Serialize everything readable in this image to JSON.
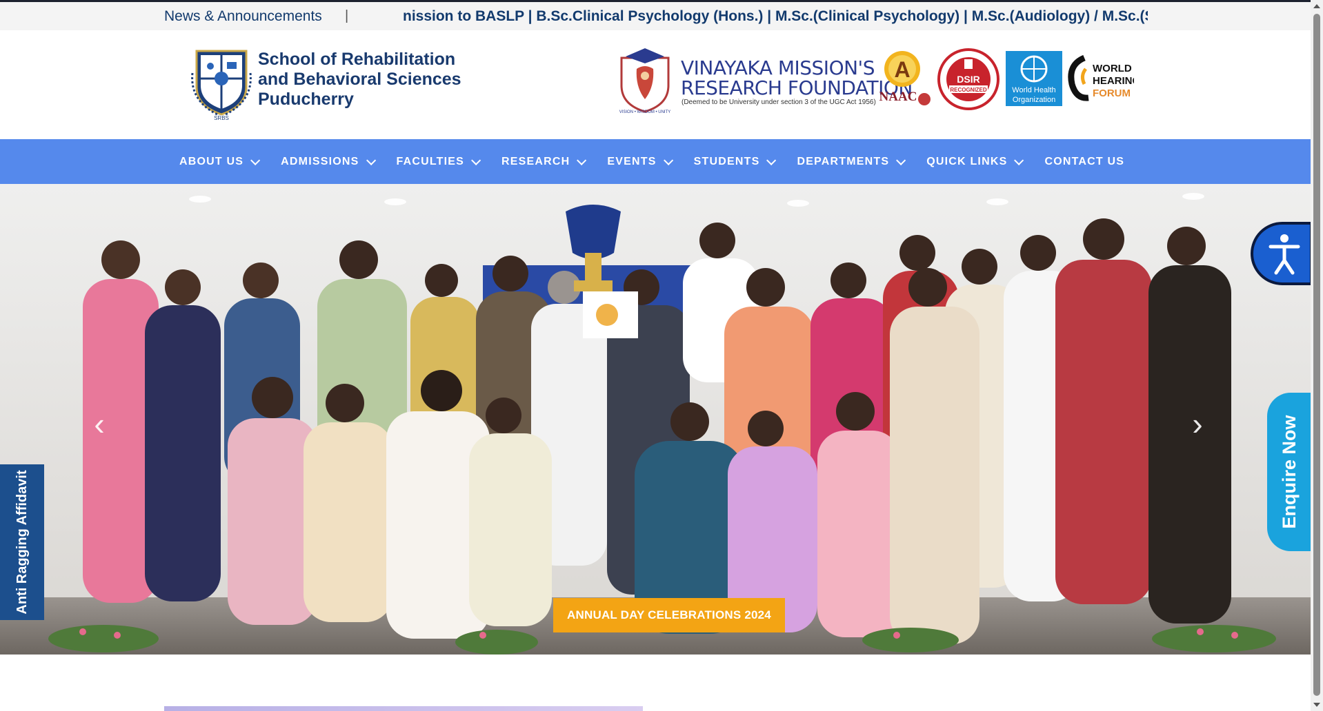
{
  "ticker": {
    "title": "News & Announcements",
    "separator": "|",
    "text": "nission to BASLP | B.Sc.Clinical Psychology (Hons.) | M.Sc.(Clinical Psychology) | M.Sc.(Audiology) / M.Sc.(Speecl"
  },
  "header": {
    "school_name": [
      "School of Rehabilitation",
      "and Behavioral Sciences",
      "Puducherry"
    ],
    "school_logo_text": "SRBS",
    "partner_name": [
      "VINAYAKA MISSION'S",
      "RESEARCH FOUNDATION"
    ],
    "partner_subtitle": "(Deemed to be University under section 3 of the UGC Act 1956)",
    "partner_logo_motto": "VISION • WISDOM • UNITY",
    "badges": {
      "naac_grade": "A",
      "naac_label": "NAAC",
      "dsir": "DSIR",
      "dsir_label": "RECOGNIZED",
      "who": "World Health Organization",
      "whf": [
        "WORLD",
        "HEARING",
        "FORUM"
      ]
    }
  },
  "nav": {
    "items": [
      {
        "label": "ABOUT US",
        "dropdown": true
      },
      {
        "label": "ADMISSIONS",
        "dropdown": true
      },
      {
        "label": "FACULTIES",
        "dropdown": true
      },
      {
        "label": "RESEARCH",
        "dropdown": true
      },
      {
        "label": "EVENTS",
        "dropdown": true
      },
      {
        "label": "STUDENTS",
        "dropdown": true
      },
      {
        "label": "DEPARTMENTS",
        "dropdown": true
      },
      {
        "label": "QUICK LINKS",
        "dropdown": true
      },
      {
        "label": "CONTACT US",
        "dropdown": false
      }
    ]
  },
  "hero": {
    "caption": "ANNUAL DAY CELEBRATIONS 2024",
    "prev_icon": "chevron-left-icon",
    "next_icon": "chevron-right-icon"
  },
  "side_tabs": {
    "anti_ragging": "Anti Ragging Affidavit",
    "enquire": "Enquire Now",
    "accessibility_icon": "accessibility-icon"
  },
  "colors": {
    "nav_bg": "#5589ec",
    "caption_bg": "#f3a414",
    "enquire_bg": "#1aa3dd",
    "anti_ragging_bg": "#1c4f8d",
    "brand_text": "#193a6e"
  }
}
